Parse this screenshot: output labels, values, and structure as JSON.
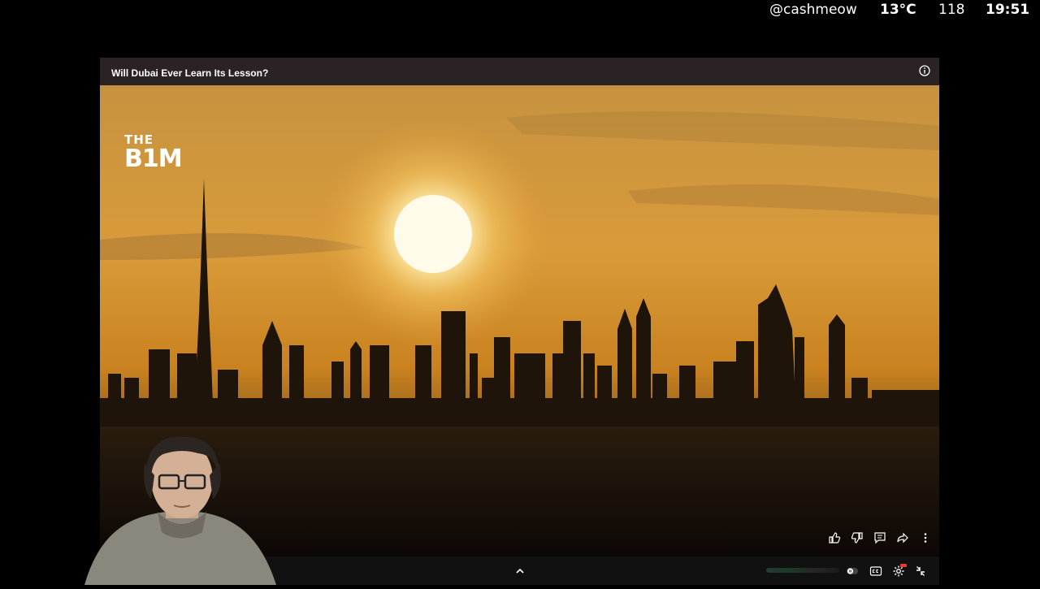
{
  "overlay": {
    "handle": "@cashmeow",
    "temperature": "13°C",
    "count": "118",
    "time": "19:51"
  },
  "player": {
    "title": "Will Dubai Ever Learn Its Lesson?",
    "brand": {
      "line1": "THE",
      "line2": "B1M"
    }
  },
  "icons": {
    "info": "info-icon",
    "like": "thumbs-up-icon",
    "dislike": "thumbs-down-icon",
    "comments": "comment-icon",
    "share": "share-icon",
    "more": "more-vert-icon",
    "expand": "chevron-up-icon",
    "autoplay": "autoplay-toggle-icon",
    "cc": "closed-captions-icon",
    "settings": "gear-icon",
    "exit_fullscreen": "exit-fullscreen-icon"
  },
  "colors": {
    "sky_top": "#c98b2e",
    "sky_mid": "#d99a38",
    "skyline": "#1c1208",
    "sun": "#fff6d8"
  }
}
